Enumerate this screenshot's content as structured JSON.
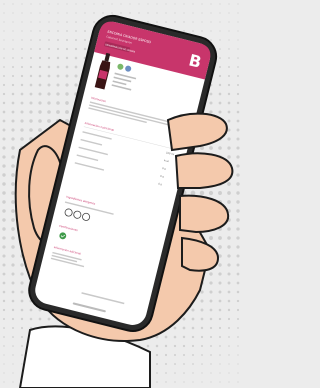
{
  "colors": {
    "background": "#ececec",
    "halftone_dot": "#cfcfcf",
    "brand": "#c8356b",
    "brand_dark": "#a82a58",
    "skin": "#f4c9ac",
    "skin_shadow": "#e7ae8e",
    "outline": "#1c1c1c",
    "phone_frame": "#2a2a2a",
    "screen_bg": "#ffffff",
    "sleeve": "#ffffff"
  },
  "screen": {
    "header": {
      "title": "ENCOMIA CRIADOR ESPOSO",
      "subtitle": "Cabernet Sauvignon",
      "badge": "DENOMINACIÓN DE ORIGEN",
      "logo_letter": "B"
    },
    "product_icons": [
      "leaf-icon",
      "globe-icon"
    ],
    "section_titles": [
      "Informacion",
      "Informacion nutricional",
      "Ingredientes alergenos",
      "Certificaciones",
      "Informacion adicional"
    ],
    "nutrition_values": [
      "100 ml",
      "kcal",
      "0 g",
      "0 g",
      "0 g"
    ],
    "recycle_icons": [
      "bottle-icon",
      "cap-icon",
      "cork-icon"
    ],
    "certification_icon": "check-icon"
  }
}
